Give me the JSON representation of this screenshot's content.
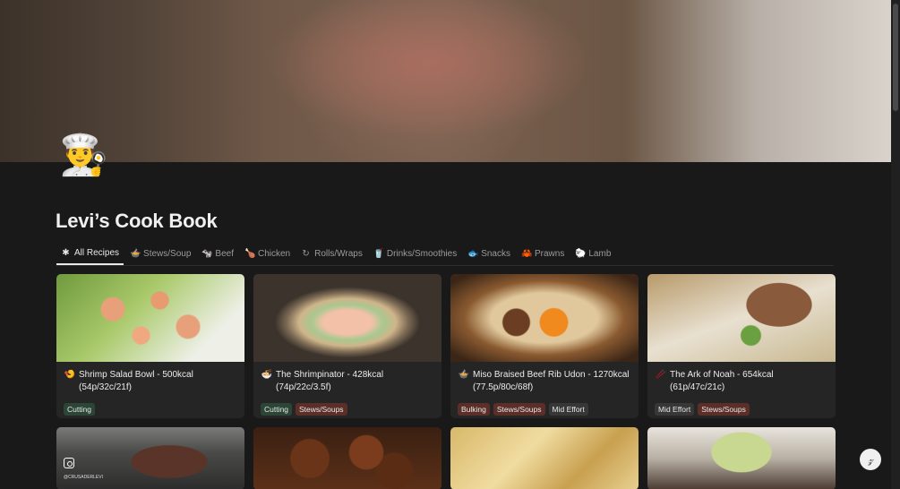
{
  "page": {
    "icon": "👨‍🍳",
    "title": "Levi’s Cook Book"
  },
  "tabs": [
    {
      "label": "All Recipes",
      "icon": "✱",
      "icon_name": "asterisk-icon"
    },
    {
      "label": "Stews/Soup",
      "icon": "🍲",
      "icon_name": "pot-icon"
    },
    {
      "label": "Beef",
      "icon": "🐄",
      "icon_name": "cow-icon"
    },
    {
      "label": "Chicken",
      "icon": "🍗",
      "icon_name": "drumstick-icon"
    },
    {
      "label": "Rolls/Wraps",
      "icon": "↻",
      "icon_name": "roll-icon"
    },
    {
      "label": "Drinks/Smoothies",
      "icon": "🥤",
      "icon_name": "cup-icon"
    },
    {
      "label": "Snacks",
      "icon": "🐟",
      "icon_name": "fish-icon"
    },
    {
      "label": "Prawns",
      "icon": "🦀",
      "icon_name": "crab-icon"
    },
    {
      "label": "Lamb",
      "icon": "🐑",
      "icon_name": "sheep-icon"
    }
  ],
  "cards": [
    {
      "icon": "🍤",
      "title": "Shrimp Salad Bowl - 500kcal (54p/32c/21f)",
      "tags": [
        {
          "label": "Cutting",
          "color": "green"
        }
      ]
    },
    {
      "icon": "🍜",
      "title": "The Shrimpinator - 428kcal (74p/22c/3.5f)",
      "tags": [
        {
          "label": "Cutting",
          "color": "green"
        },
        {
          "label": "Stews/Soups",
          "color": "red"
        }
      ]
    },
    {
      "icon": "🍲",
      "title": "Miso Braised Beef Rib Udon - 1270kcal (77.5p/80c/68f)",
      "tags": [
        {
          "label": "Bulking",
          "color": "red"
        },
        {
          "label": "Stews/Soups",
          "color": "red"
        },
        {
          "label": "Mid Effort",
          "color": "gray"
        }
      ]
    },
    {
      "icon": "🥢",
      "title": "The Ark of Noah - 654kcal (61p/47c/21c)",
      "tags": [
        {
          "label": "Mid Effort",
          "color": "gray"
        },
        {
          "label": "Stews/Soups",
          "color": "red"
        }
      ]
    }
  ],
  "instagram_watermark": "@CRUSADERLEVI",
  "help_button": "𝓏"
}
